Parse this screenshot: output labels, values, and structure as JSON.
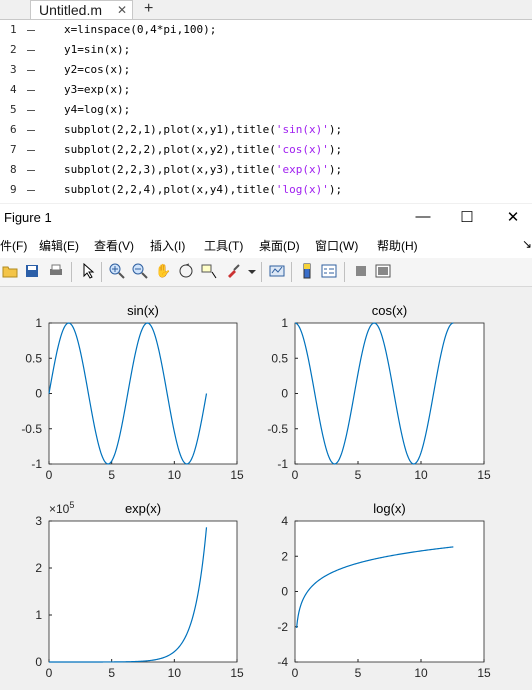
{
  "editor": {
    "tab_label": "Untitled.m",
    "tab_close": "✕",
    "add_tab": "+",
    "lines": [
      {
        "n": "1",
        "pre": "x=linspace(0,4*pi,100);",
        "str": "",
        "post": ""
      },
      {
        "n": "2",
        "pre": "y1=sin(x);",
        "str": "",
        "post": ""
      },
      {
        "n": "3",
        "pre": "y2=cos(x);",
        "str": "",
        "post": ""
      },
      {
        "n": "4",
        "pre": "y3=exp(x);",
        "str": "",
        "post": ""
      },
      {
        "n": "5",
        "pre": "y4=log(x);",
        "str": "",
        "post": ""
      },
      {
        "n": "6",
        "pre": "subplot(2,2,1),plot(x,y1),title(",
        "str": "'sin(x)'",
        "post": ");"
      },
      {
        "n": "7",
        "pre": "subplot(2,2,2),plot(x,y2),title(",
        "str": "'cos(x)'",
        "post": ");"
      },
      {
        "n": "8",
        "pre": "subplot(2,2,3),plot(x,y3),title(",
        "str": "'exp(x)'",
        "post": ");"
      },
      {
        "n": "9",
        "pre": "subplot(2,2,4),plot(x,y4),title(",
        "str": "'log(x)'",
        "post": ");"
      }
    ]
  },
  "figure": {
    "title": "Figure 1",
    "min_glyph": "—",
    "max_glyph": "☐",
    "close_glyph": "✕",
    "menu": [
      "件(F)",
      "编辑(E)",
      "查看(V)",
      "插入(I)",
      "工具(T)",
      "桌面(D)",
      "窗口(W)",
      "帮助(H)"
    ],
    "menu_overflow": "↘",
    "toolbar_icons": [
      "open-icon",
      "save-icon",
      "print-icon",
      "pointer-icon",
      "zoom-in-icon",
      "zoom-out-icon",
      "pan-icon",
      "rotate-icon",
      "data-cursor-icon",
      "brush-icon",
      "dropdown-icon",
      "link-plot-icon",
      "colorbar-icon",
      "legend-icon",
      "hide-plot-tools-icon",
      "show-plot-tools-icon"
    ]
  },
  "colors": {
    "line": "#0072bd",
    "string": "#a020f0"
  },
  "chart_data": [
    {
      "type": "line",
      "title": "sin(x)",
      "xlim": [
        0,
        15
      ],
      "ylim": [
        -1,
        1
      ],
      "xticks": [
        "0",
        "5",
        "10",
        "15"
      ],
      "yticks": [
        "-1",
        "-0.5",
        "0",
        "0.5",
        "1"
      ],
      "func": "sin",
      "x_range": [
        0,
        12.566
      ]
    },
    {
      "type": "line",
      "title": "cos(x)",
      "xlim": [
        0,
        15
      ],
      "ylim": [
        -1,
        1
      ],
      "xticks": [
        "0",
        "5",
        "10",
        "15"
      ],
      "yticks": [
        "-1",
        "-0.5",
        "0",
        "0.5",
        "1"
      ],
      "func": "cos",
      "x_range": [
        0,
        12.566
      ]
    },
    {
      "type": "line",
      "title": "exp(x)",
      "xlim": [
        0,
        15
      ],
      "ylim": [
        0,
        300000
      ],
      "exponent_label": "×10^5",
      "xticks": [
        "0",
        "5",
        "10",
        "15"
      ],
      "yticks": [
        "0",
        "1",
        "2",
        "3"
      ],
      "func": "exp",
      "x_range": [
        0,
        12.566
      ]
    },
    {
      "type": "line",
      "title": "log(x)",
      "xlim": [
        0,
        15
      ],
      "ylim": [
        -4,
        4
      ],
      "xticks": [
        "0",
        "5",
        "10",
        "15"
      ],
      "yticks": [
        "-4",
        "-2",
        "0",
        "2",
        "4"
      ],
      "func": "log",
      "x_range": [
        0.1269,
        12.566
      ]
    }
  ]
}
